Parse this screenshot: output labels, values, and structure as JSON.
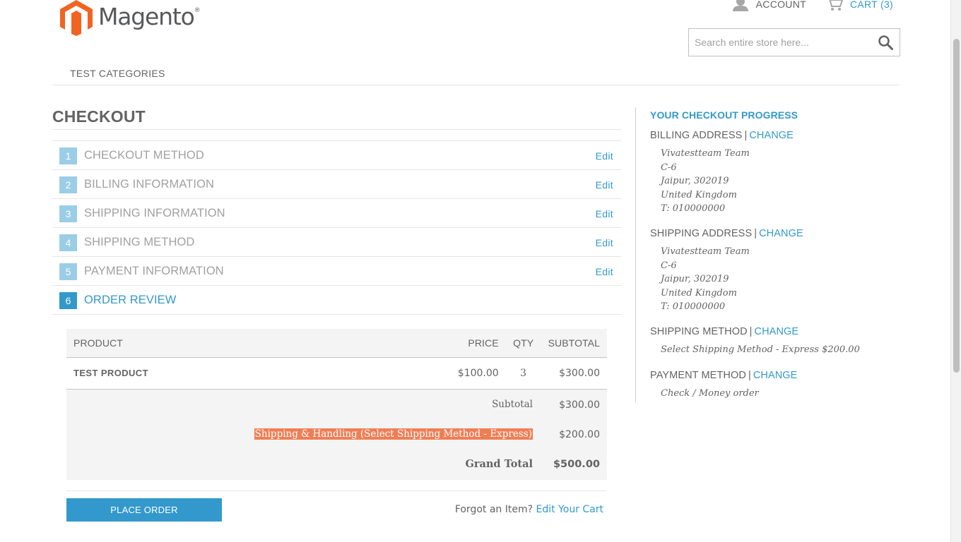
{
  "header": {
    "logo_text": "Magento",
    "logo_mark": "®",
    "account_label": "ACCOUNT",
    "cart_label": "CART",
    "cart_count": "(3)",
    "search_placeholder": "Search entire store here...",
    "brand_color": "#f26322",
    "accent_color": "#3399cc"
  },
  "nav": {
    "items": [
      {
        "label": "TEST CATEGORIES"
      }
    ]
  },
  "checkout": {
    "title": "CHECKOUT",
    "steps": [
      {
        "num": "1",
        "title": "CHECKOUT METHOD",
        "edit": "Edit"
      },
      {
        "num": "2",
        "title": "BILLING INFORMATION",
        "edit": "Edit"
      },
      {
        "num": "3",
        "title": "SHIPPING INFORMATION",
        "edit": "Edit"
      },
      {
        "num": "4",
        "title": "SHIPPING METHOD",
        "edit": "Edit"
      },
      {
        "num": "5",
        "title": "PAYMENT INFORMATION",
        "edit": "Edit"
      },
      {
        "num": "6",
        "title": "ORDER REVIEW",
        "edit": ""
      }
    ]
  },
  "review": {
    "columns": {
      "product": "PRODUCT",
      "price": "PRICE",
      "qty": "QTY",
      "subtotal": "SUBTOTAL"
    },
    "items": [
      {
        "name": "TEST PRODUCT",
        "price": "$100.00",
        "qty": "3",
        "subtotal": "$300.00"
      }
    ],
    "totals": {
      "subtotal_label": "Subtotal",
      "subtotal_value": "$300.00",
      "shipping_label": "Shipping & Handling (Select Shipping Method - Express)",
      "shipping_value": "$200.00",
      "grand_label": "Grand Total",
      "grand_value": "$500.00"
    },
    "place_order": "PLACE ORDER",
    "forgot_text": "Forgot an Item?",
    "edit_cart": "Edit Your Cart",
    "highlight_color": "#ef7e55"
  },
  "progress": {
    "title": "YOUR CHECKOUT PROGRESS",
    "change": "CHANGE",
    "separator": "|",
    "billing": {
      "label": "BILLING ADDRESS",
      "lines": [
        "Vivatestteam Team",
        "C-6",
        "Jaipur, 302019",
        "United Kingdom",
        "T: 010000000"
      ]
    },
    "shipping": {
      "label": "SHIPPING ADDRESS",
      "lines": [
        "Vivatestteam Team",
        "C-6",
        "Jaipur, 302019",
        "United Kingdom",
        "T: 010000000"
      ]
    },
    "shipping_method": {
      "label": "SHIPPING METHOD",
      "value": "Select Shipping Method - Express $200.00"
    },
    "payment_method": {
      "label": "PAYMENT METHOD",
      "value": "Check / Money order"
    }
  }
}
